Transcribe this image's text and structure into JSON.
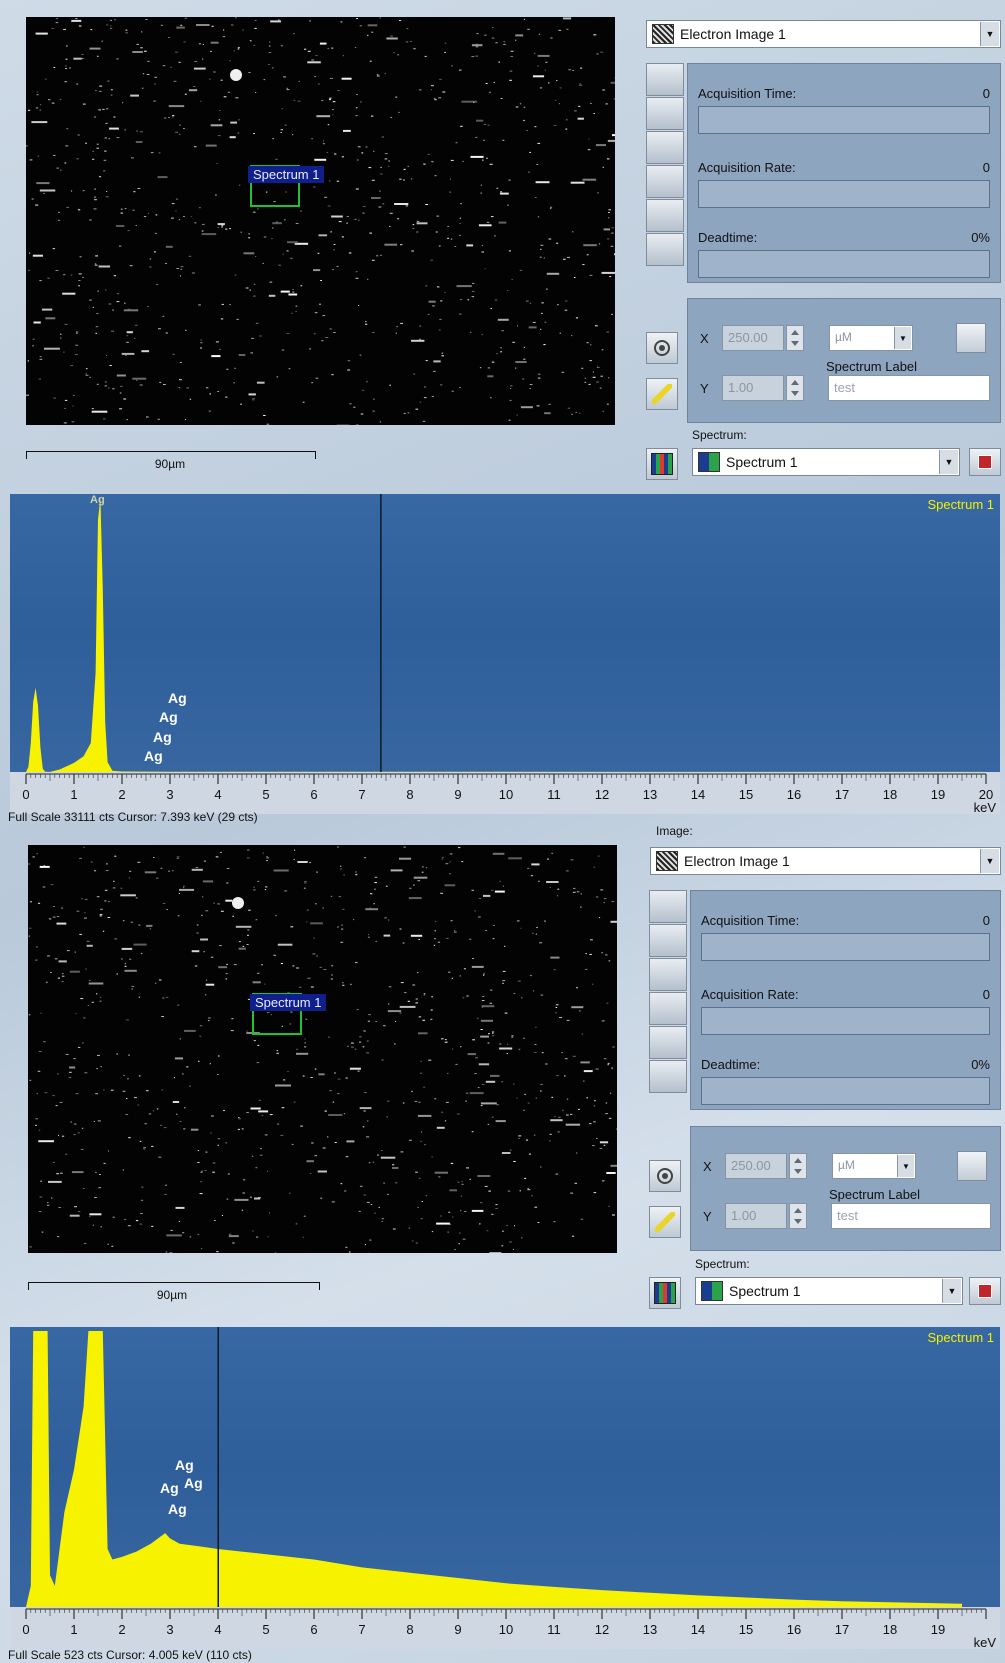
{
  "colors": {
    "spectrum_fill": "#f6f200",
    "chart_bg": "#3564a0",
    "roi_border": "#22c02e",
    "roi_label_bg": "#0f1f8c",
    "cursor_line": "#0d1a2b",
    "label_yellow": "#f4f000"
  },
  "panels": [
    {
      "image_section_label": "",
      "image_dropdown": {
        "label": "Electron Image 1",
        "icon": "electron-image-icon"
      },
      "roi": {
        "label": "Spectrum 1"
      },
      "scale_bar": "90µm",
      "acquisition": {
        "time_label": "Acquisition Time:",
        "time_value": "0",
        "rate_label": "Acquisition Rate:",
        "rate_value": "0",
        "deadtime_label": "Deadtime:",
        "deadtime_value": "0%"
      },
      "position": {
        "x_label": "X",
        "x_value": "250.00",
        "y_label": "Y",
        "y_value": "1.00",
        "unit": "µM",
        "spectrum_label_caption": "Spectrum Label",
        "spectrum_label_value": "test"
      },
      "spectrum_section_label": "Spectrum:",
      "spectrum_dropdown": "Spectrum 1",
      "chart_name": "Spectrum 1",
      "status": "Full Scale 33111 cts  Cursor: 7.393 keV (29 cts)",
      "peak_top_label": "Ag",
      "peak_labels": [
        "Ag",
        "Ag",
        "Ag",
        "Ag"
      ]
    },
    {
      "image_section_label": "Image:",
      "image_dropdown": {
        "label": "Electron Image 1",
        "icon": "electron-image-icon"
      },
      "roi": {
        "label": "Spectrum 1"
      },
      "scale_bar": "90µm",
      "acquisition": {
        "time_label": "Acquisition Time:",
        "time_value": "0",
        "rate_label": "Acquisition Rate:",
        "rate_value": "0",
        "deadtime_label": "Deadtime:",
        "deadtime_value": "0%"
      },
      "position": {
        "x_label": "X",
        "x_value": "250.00",
        "y_label": "Y",
        "y_value": "1.00",
        "unit": "µM",
        "spectrum_label_caption": "Spectrum Label",
        "spectrum_label_value": "test"
      },
      "spectrum_section_label": "Spectrum:",
      "spectrum_dropdown": "Spectrum 1",
      "chart_name": "Spectrum 1",
      "status": "Full Scale 523 cts  Cursor: 4.005 keV (110 cts)",
      "peak_top_label": "",
      "peak_labels": [
        "Ag",
        "Ag",
        "Ag",
        "Ag"
      ]
    }
  ],
  "chart_data": [
    {
      "type": "area",
      "title": "Spectrum 1",
      "xlabel": "keV",
      "xlim": [
        0,
        20
      ],
      "full_scale_cts": 33111,
      "cursor_kev": 7.393,
      "cursor_cts": 29,
      "x": [
        0,
        0.05,
        0.1,
        0.15,
        0.2,
        0.25,
        0.3,
        0.35,
        0.4,
        0.5,
        0.7,
        1.0,
        1.2,
        1.35,
        1.45,
        1.5,
        1.55,
        1.6,
        1.65,
        1.7,
        1.8,
        2.0,
        3.0,
        5.0,
        10.0,
        20.0
      ],
      "y": [
        0,
        600,
        3500,
        8500,
        10200,
        8000,
        3000,
        400,
        20,
        10,
        300,
        1100,
        1900,
        3500,
        12000,
        30500,
        33111,
        22000,
        6000,
        1200,
        150,
        60,
        40,
        30,
        20,
        10
      ],
      "x_ticks": [
        0,
        1,
        2,
        3,
        4,
        5,
        6,
        7,
        8,
        9,
        10,
        11,
        12,
        13,
        14,
        15,
        16,
        17,
        18,
        19,
        20
      ]
    },
    {
      "type": "area",
      "title": "Spectrum 1",
      "xlabel": "keV",
      "xlim": [
        0,
        20
      ],
      "full_scale_cts": 523,
      "cursor_kev": 4.005,
      "cursor_cts": 110,
      "x": [
        0,
        0.1,
        0.15,
        0.3,
        0.45,
        0.5,
        0.6,
        0.8,
        1.0,
        1.2,
        1.3,
        1.4,
        1.5,
        1.6,
        1.7,
        1.8,
        2.0,
        2.3,
        2.6,
        2.9,
        3.0,
        3.2,
        3.6,
        4.0,
        4.5,
        5.0,
        6.0,
        7.0,
        8.0,
        9.0,
        10.0,
        11.0,
        12.0,
        13.0,
        14.0,
        15.0,
        16.0,
        17.0,
        18.0,
        19.0,
        19.5
      ],
      "y": [
        0,
        40,
        523,
        523,
        523,
        60,
        40,
        180,
        260,
        380,
        523,
        523,
        523,
        523,
        110,
        90,
        95,
        105,
        120,
        140,
        130,
        120,
        115,
        110,
        105,
        100,
        90,
        75,
        65,
        55,
        45,
        38,
        32,
        27,
        22,
        18,
        14,
        11,
        9,
        7,
        6
      ],
      "x_ticks": [
        0,
        1,
        2,
        3,
        4,
        5,
        6,
        7,
        8,
        9,
        10,
        11,
        12,
        13,
        14,
        15,
        16,
        17,
        18,
        19
      ]
    }
  ]
}
